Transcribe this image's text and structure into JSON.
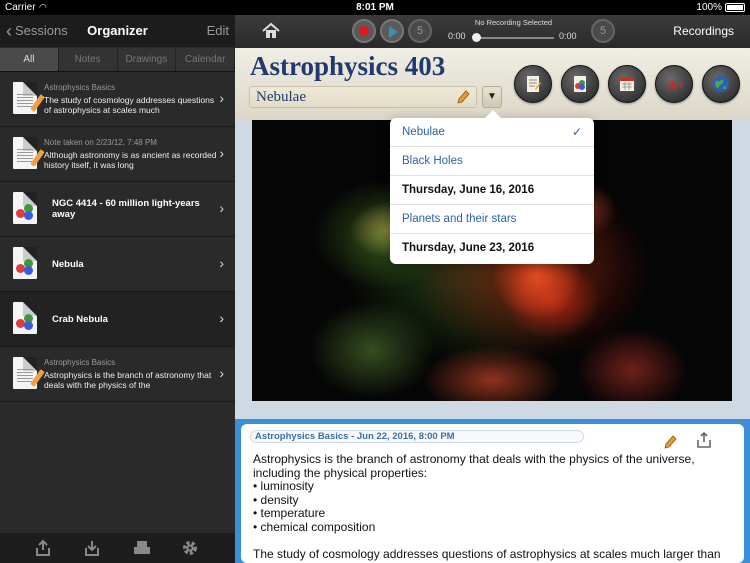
{
  "status_bar": {
    "carrier": "Carrier",
    "time": "8:01 PM",
    "battery": "100%"
  },
  "sidebar": {
    "back_label": "Sessions",
    "title": "Organizer",
    "edit_label": "Edit",
    "tabs": [
      {
        "label": "All",
        "active": true
      },
      {
        "label": "Notes",
        "active": false
      },
      {
        "label": "Drawings",
        "active": false
      },
      {
        "label": "Calendar",
        "active": false
      }
    ],
    "items": [
      {
        "subtitle": "Astrophysics Basics",
        "body": "The study of cosmology addresses questions of astrophysics at scales much",
        "icon": "note-document-icon"
      },
      {
        "subtitle": "Note taken on 2/23/12, 7:48 PM",
        "body": "Although astronomy is as ancient as recorded history itself, it was long",
        "icon": "note-document-icon"
      },
      {
        "title": "NGC 4414 - 60 million light-years away",
        "icon": "drawing-document-icon"
      },
      {
        "title": "Nebula",
        "icon": "drawing-document-icon"
      },
      {
        "title": "Crab Nebula",
        "icon": "drawing-document-icon"
      },
      {
        "subtitle": "Astrophysics Basics",
        "body": "Astrophysics is the branch of astronomy that deals with the physics of the",
        "icon": "note-document-icon"
      }
    ],
    "footer_icons": [
      "export-icon",
      "download-icon",
      "print-icon",
      "settings-icon"
    ]
  },
  "toolbar": {
    "recording_name": "No Recording Selected",
    "time_start": "0:00",
    "time_end": "0:00",
    "recordings_label": "Recordings",
    "skip_back_label": "5",
    "skip_forward_label": "5"
  },
  "header": {
    "notebook_title": "Astrophysics 403",
    "section": "Nebulae",
    "buttons": [
      "new-note-icon",
      "drawing-icon",
      "calendar-icon",
      "grade-icon",
      "globe-icon"
    ],
    "grade_label": "A+"
  },
  "section_dropdown": {
    "items": [
      {
        "label": "Nebulae",
        "style": "blue",
        "selected": true
      },
      {
        "label": "Black Holes",
        "style": "blue",
        "selected": false
      },
      {
        "label": "Thursday, June 16, 2016",
        "style": "black",
        "selected": false
      },
      {
        "label": "Planets and their stars",
        "style": "blue",
        "selected": false
      },
      {
        "label": "Thursday, June 23, 2016",
        "style": "black",
        "selected": false
      }
    ],
    "check_mark": "✓"
  },
  "note": {
    "header": "Astrophysics Basics - Jun 22, 2016, 8:00 PM",
    "intro": "Astrophysics is the branch of astronomy that deals with the physics of the universe, including the physical properties:",
    "bullets": [
      "• luminosity",
      "• density",
      "• temperature",
      "• chemical composition"
    ],
    "second_para": "The study of cosmology addresses questions of astrophysics at scales much larger than"
  },
  "colors": {
    "accent_blue": "#3b8fd8",
    "title_navy": "#1e3a6e",
    "record_red": "#e01818",
    "link_blue": "#2f63a6"
  }
}
